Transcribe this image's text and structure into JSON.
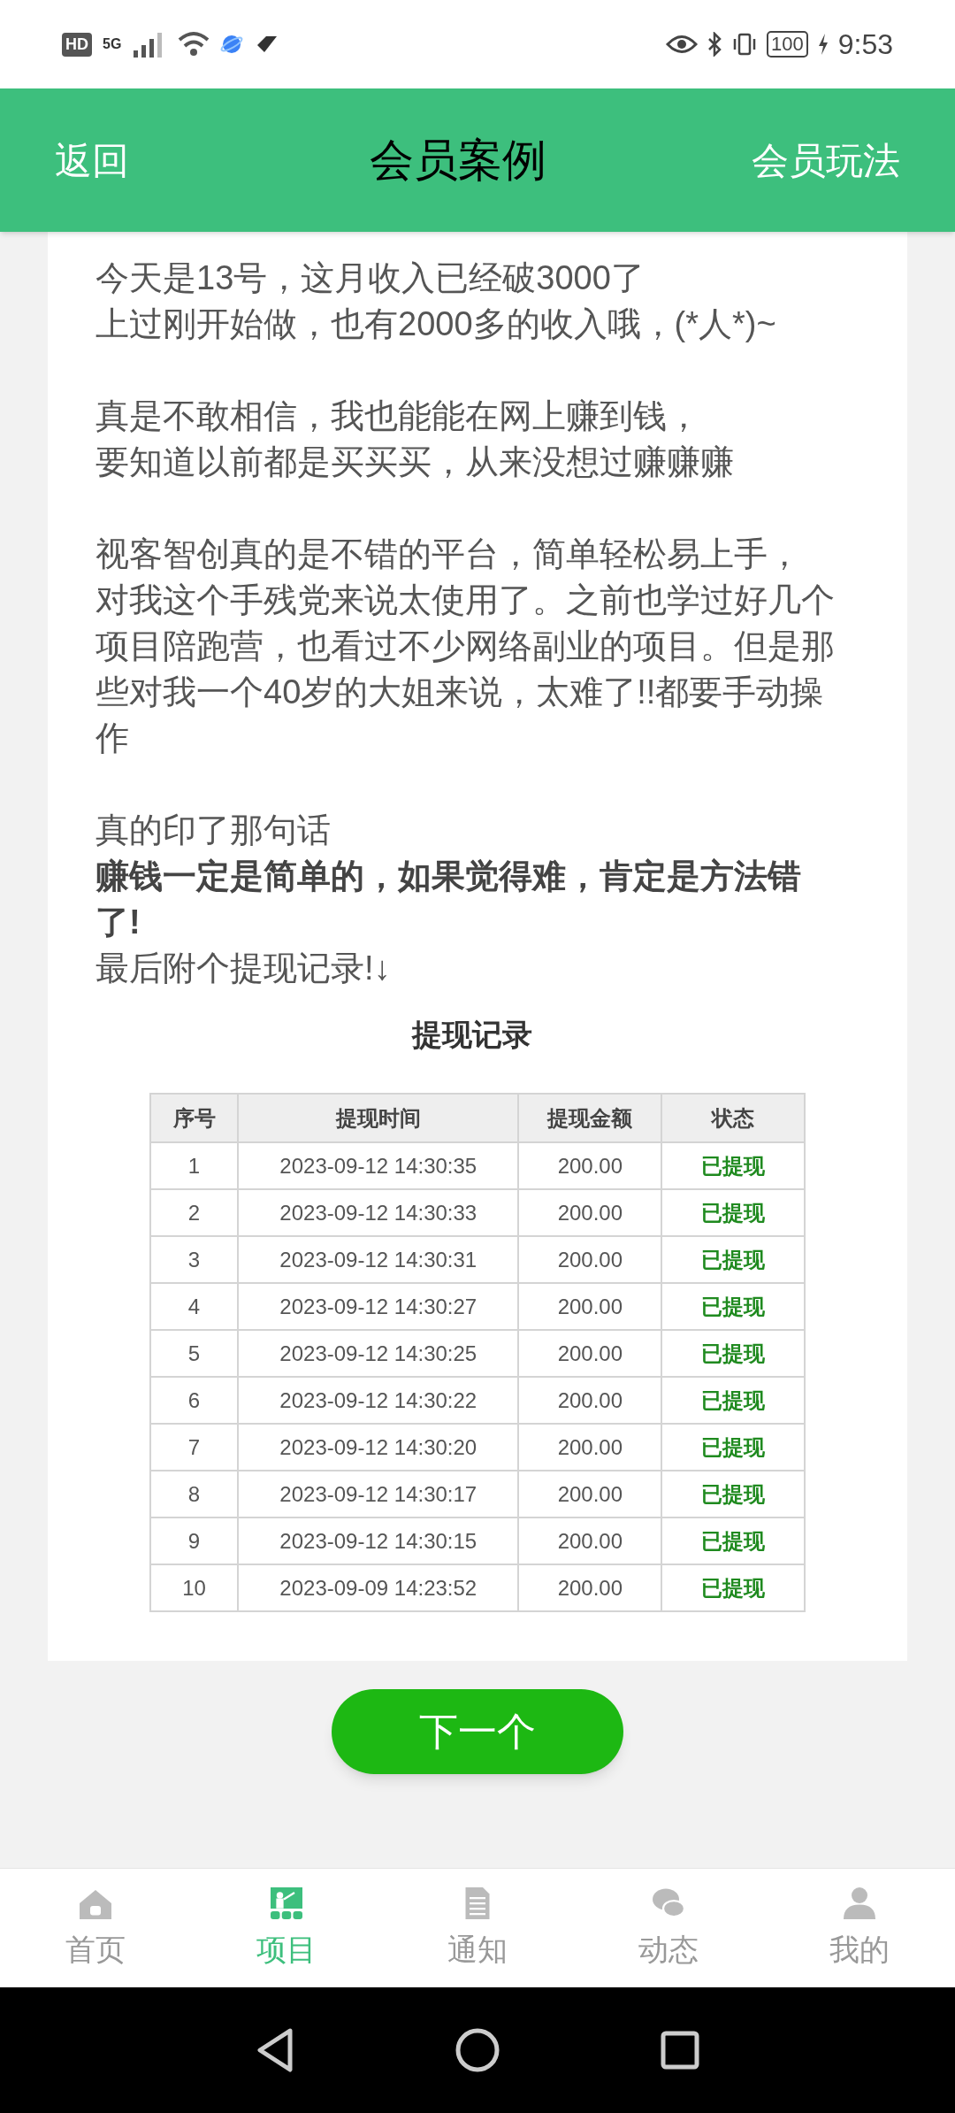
{
  "status_bar": {
    "hd": "HD",
    "time": "9:53",
    "battery": "100",
    "network": "5G"
  },
  "header": {
    "back": "返回",
    "title": "会员案例",
    "action": "会员玩法"
  },
  "paragraphs": [
    {
      "lines": [
        {
          "text": "今天是13号，这月收入已经破3000了",
          "bold": false
        },
        {
          "text": "上过刚开始做，也有2000多的收入哦，(*人*)~",
          "bold": false
        }
      ]
    },
    {
      "lines": [
        {
          "text": "真是不敢相信，我也能能在网上赚到钱，",
          "bold": false
        },
        {
          "text": "要知道以前都是买买买，从来没想过赚赚赚",
          "bold": false
        }
      ]
    },
    {
      "lines": [
        {
          "text": "视客智创真的是不错的平台，简单轻松易上手，",
          "bold": false
        },
        {
          "text": "对我这个手残党来说太使用了。之前也学过好几个项目陪跑营，也看过不少网络副业的项目。但是那些对我一个40岁的大姐来说，太难了!!都要手动操作",
          "bold": false
        }
      ]
    },
    {
      "lines": [
        {
          "text": "真的印了那句话",
          "bold": false
        },
        {
          "text": "赚钱一定是简单的，如果觉得难，肯定是方法错了!",
          "bold": true
        },
        {
          "text": "最后附个提现记录!↓",
          "bold": false
        }
      ]
    }
  ],
  "record": {
    "title": "提现记录",
    "columns": [
      "序号",
      "提现时间",
      "提现金额",
      "状态"
    ],
    "rows": [
      [
        "1",
        "2023-09-12 14:30:35",
        "200.00",
        "已提现"
      ],
      [
        "2",
        "2023-09-12 14:30:33",
        "200.00",
        "已提现"
      ],
      [
        "3",
        "2023-09-12 14:30:31",
        "200.00",
        "已提现"
      ],
      [
        "4",
        "2023-09-12 14:30:27",
        "200.00",
        "已提现"
      ],
      [
        "5",
        "2023-09-12 14:30:25",
        "200.00",
        "已提现"
      ],
      [
        "6",
        "2023-09-12 14:30:22",
        "200.00",
        "已提现"
      ],
      [
        "7",
        "2023-09-12 14:30:20",
        "200.00",
        "已提现"
      ],
      [
        "8",
        "2023-09-12 14:30:17",
        "200.00",
        "已提现"
      ],
      [
        "9",
        "2023-09-12 14:30:15",
        "200.00",
        "已提现"
      ],
      [
        "10",
        "2023-09-09 14:23:52",
        "200.00",
        "已提现"
      ]
    ]
  },
  "next_button": "下一个",
  "tabs": [
    {
      "label": "首页",
      "kind": "home",
      "selected": false
    },
    {
      "label": "项目",
      "kind": "class",
      "selected": true
    },
    {
      "label": "通知",
      "kind": "doc",
      "selected": false
    },
    {
      "label": "动态",
      "kind": "chat",
      "selected": false
    },
    {
      "label": "我的",
      "kind": "user",
      "selected": false
    }
  ]
}
